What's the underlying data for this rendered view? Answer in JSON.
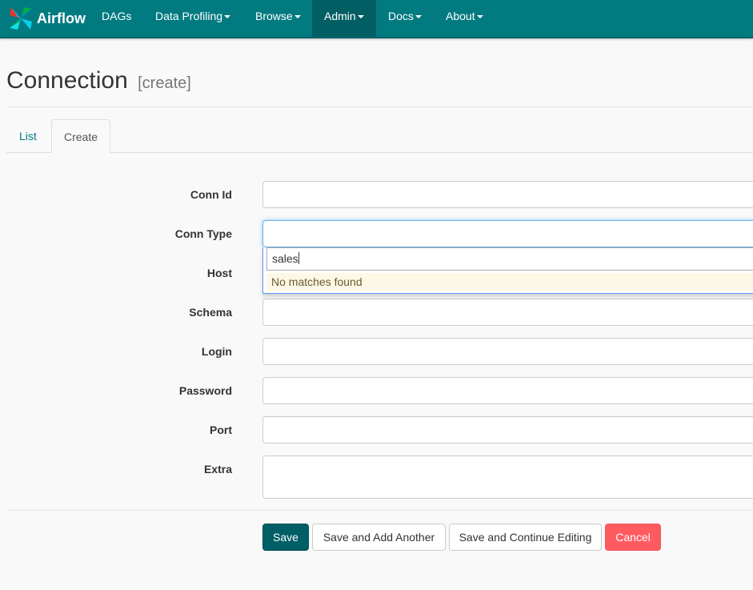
{
  "navbar": {
    "brand": "Airflow",
    "items": [
      {
        "label": "DAGs",
        "dropdown": false,
        "active": false
      },
      {
        "label": "Data Profiling",
        "dropdown": true,
        "active": false
      },
      {
        "label": "Browse",
        "dropdown": true,
        "active": false
      },
      {
        "label": "Admin",
        "dropdown": true,
        "active": true
      },
      {
        "label": "Docs",
        "dropdown": true,
        "active": false
      },
      {
        "label": "About",
        "dropdown": true,
        "active": false
      }
    ],
    "color": "#017a80",
    "active_color": "#025e63"
  },
  "page": {
    "title": "Connection",
    "subtitle": "[create]"
  },
  "tabs": [
    {
      "label": "List",
      "active": false
    },
    {
      "label": "Create",
      "active": true
    }
  ],
  "form": {
    "fields": [
      {
        "label": "Conn Id",
        "value": ""
      },
      {
        "label": "Conn Type",
        "value": ""
      },
      {
        "label": "Host",
        "value": ""
      },
      {
        "label": "Schema",
        "value": ""
      },
      {
        "label": "Login",
        "value": ""
      },
      {
        "label": "Password",
        "value": ""
      },
      {
        "label": "Port",
        "value": ""
      },
      {
        "label": "Extra",
        "value": ""
      }
    ],
    "conn_type_dropdown": {
      "search_value": "sales",
      "no_results_text": "No matches found"
    }
  },
  "buttons": {
    "save": "Save",
    "save_add_another": "Save and Add Another",
    "save_continue": "Save and Continue Editing",
    "cancel": "Cancel"
  }
}
